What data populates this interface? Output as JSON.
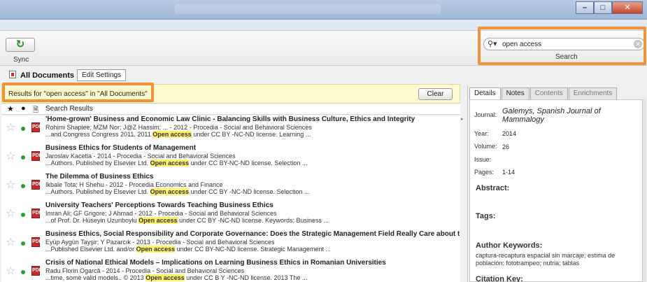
{
  "toolbar": {
    "sync_label": "Sync",
    "sync_icon": "refresh-icon"
  },
  "search": {
    "value": "open access",
    "label": "Search",
    "icon": "search-icon"
  },
  "tabs": {
    "all_documents": "All Documents",
    "edit_settings": "Edit Settings"
  },
  "banner": {
    "text": "Results for \"open access\" in \"All Documents\"",
    "clear": "Clear"
  },
  "list_header": {
    "star": "★",
    "dot": "●",
    "doc": "🗎",
    "title": "Search Results"
  },
  "results": [
    {
      "title": "'Home-grown' Business and Economic Law Clinic - Balancing Skills with Business Culture, Ethics and Integrity",
      "meta": "Rohimi Shapiee; MZM Nor; J@Z Hassim; ... - 2012 - Procedia - Social and Behavioral Sciences",
      "snip_before": "...and Congress Congress 2011. 2011 ",
      "snip_hl": "Open access",
      "snip_after": " under CC BY -NC-ND license. Learning ..."
    },
    {
      "title": "Business Ethics for Students of Management",
      "meta": "Jaroslav Kacetla - 2014 - Procedia - Social and Behavioral Sciences",
      "snip_before": "...Authors. Published by Elsevier Ltd. ",
      "snip_hl": "Open access",
      "snip_after": " under CC BY-NC-ND license. Selection ..."
    },
    {
      "title": "The Dilemma of Business Ethics",
      "meta": "Ikbale Tota; H Shehu - 2012 - Procedia Economics and Finance",
      "snip_before": "...Authors. Published by Elsevier Ltd. ",
      "snip_hl": "Open access",
      "snip_after": " under CC BY -NC-ND license. Selection ..."
    },
    {
      "title": "University Teachers' Perceptions Towards Teaching Business Ethics",
      "meta": "Imran Ali; GF Grigore; J Ahmad - 2012 - Procedia - Social and Behavioral Sciences",
      "snip_before": "...of Prof. Dr. Hüseyin Uzunboylu ",
      "snip_hl": "Open access",
      "snip_after": " under CC BY -NC-ND license. Keywords: Business ..."
    },
    {
      "title": "Business Ethics, Social Responsibility and Corporate Governance: Does the Strategic Management Field Really Care about these Conce",
      "meta": "Eyüp Aygün Tayşir; Y Pazarcık - 2013 - Procedia - Social and Behavioral Sciences",
      "snip_before": "...Published Elsevier Ltd. and/or ",
      "snip_hl": "Open access",
      "snip_after": " under CC BY-NC-ND license. Strategic Management ..."
    },
    {
      "title": "Crisis of National Ethical Models – Implications on Learning Business Ethics in Romanian Universities",
      "meta": "Radu Florin Ogarcă - 2014 - Procedia - Social and Behavioral Sciences",
      "snip_before": "...time, some valid models.. © 2013 ",
      "snip_hl": "Open access",
      "snip_after": " under CC B Y -NC-ND license. 2013 The ..."
    }
  ],
  "panel": {
    "tabs": [
      "Details",
      "Notes",
      "Contents",
      "Enrichments"
    ],
    "journal_label": "Journal:",
    "journal_value": "Galemys, Spanish Journal of Mammalogy",
    "year_label": "Year:",
    "year_value": "2014",
    "volume_label": "Volume:",
    "volume_value": "26",
    "issue_label": "Issue:",
    "issue_value": "",
    "pages_label": "Pages:",
    "pages_value": "1-14",
    "abstract": "Abstract:",
    "tags": "Tags:",
    "author_keywords": "Author Keywords:",
    "keywords_value": "captura-recaptura espacial sin marcaje; estima de población; fototrampeo; nutria; tablas",
    "citation_key": "Citation Key:"
  },
  "colors": {
    "highlight_border": "#f0923a",
    "search_highlight": "#fff36b",
    "banner_bg": "#fffbd0",
    "unread_dot": "#2e9b2e",
    "pdf_icon": "#c62a2a"
  }
}
